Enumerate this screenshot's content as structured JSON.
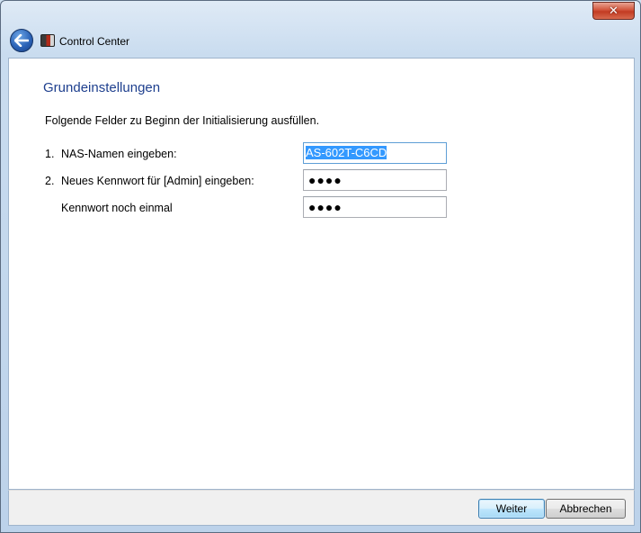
{
  "window": {
    "title": "Control Center",
    "close_glyph": "✕"
  },
  "content": {
    "heading": "Grundeinstellungen",
    "intro": "Folgende Felder zu Beginn der Initialisierung ausfüllen.",
    "rows": [
      {
        "number": "1.",
        "label": "NAS-Namen eingeben:",
        "value": "AS-602T-C6CD"
      },
      {
        "number": "2.",
        "label": "Neues Kennwort für [Admin] eingeben:",
        "value": "●●●●"
      },
      {
        "number": "",
        "label": "Kennwort noch einmal",
        "value": "●●●●"
      }
    ]
  },
  "footer": {
    "next_label": "Weiter",
    "cancel_label": "Abbrechen"
  },
  "colors": {
    "heading": "#1e3f8e",
    "selection": "#3399ff"
  }
}
